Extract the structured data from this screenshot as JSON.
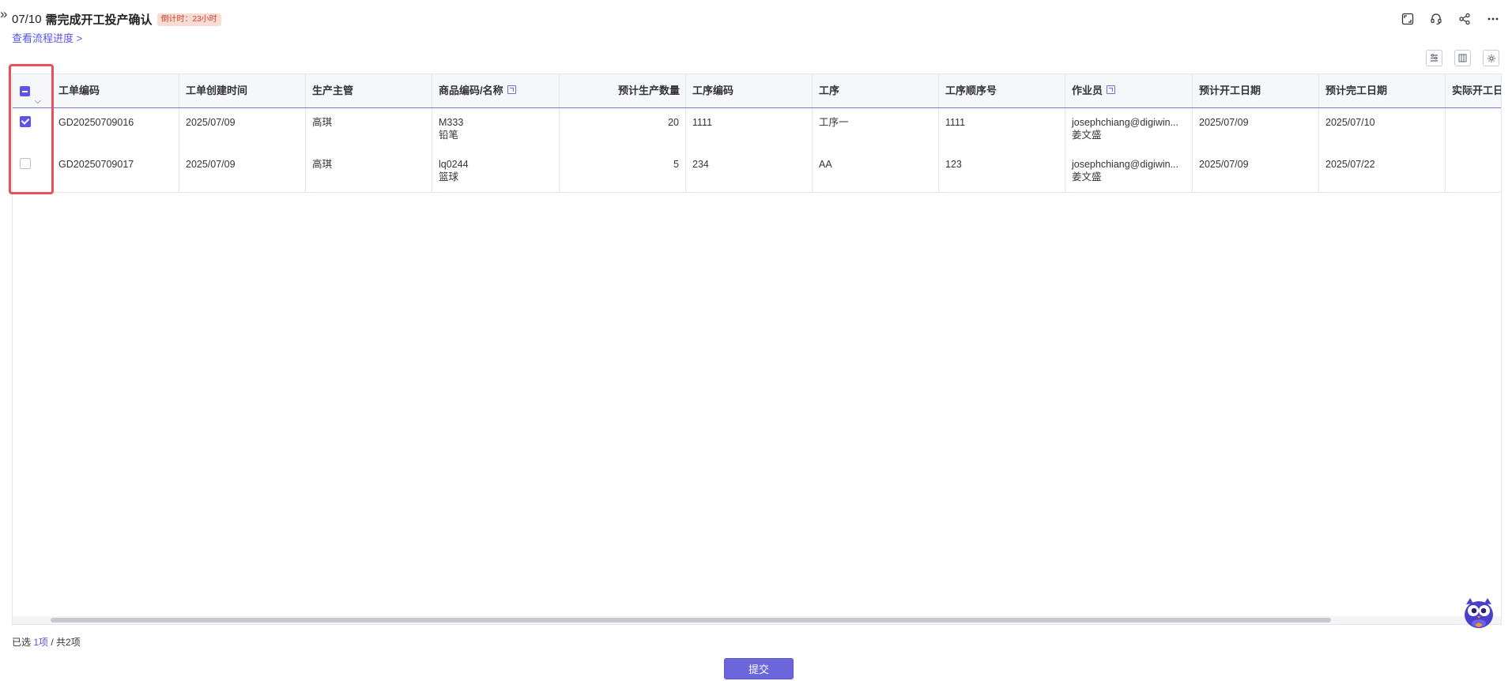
{
  "header": {
    "collapse_glyph": "»",
    "date": "07/10",
    "title": "需完成开工投产确认",
    "countdown": "倒计时：23小时",
    "progress_link": "查看流程进度 >"
  },
  "top_icons": [
    "fullscreen-icon",
    "headset-icon",
    "share-icon",
    "more-icon"
  ],
  "toolbar_icons": [
    "filter-settings-icon",
    "column-freeze-icon",
    "settings-icon"
  ],
  "table": {
    "columns": [
      {
        "label": "工单编码"
      },
      {
        "label": "工单创建时间"
      },
      {
        "label": "生产主管"
      },
      {
        "label": "商品编码/名称"
      },
      {
        "label": "预计生产数量"
      },
      {
        "label": "工序编码"
      },
      {
        "label": "工序"
      },
      {
        "label": "工序顺序号"
      },
      {
        "label": "作业员"
      },
      {
        "label": "预计开工日期"
      },
      {
        "label": "预计完工日期"
      },
      {
        "label": "实际开工日期"
      }
    ],
    "rows": [
      {
        "checked": true,
        "order_no": "GD20250709016",
        "created": "2025/07/09",
        "supervisor": "高琪",
        "item_code": "M333",
        "item_name": "铅笔",
        "qty": "20",
        "process_code": "1111",
        "process": "工序一",
        "seq": "1111",
        "operator_email": "josephchiang@digiwin...",
        "operator_name": "姜文盛",
        "plan_start": "2025/07/09",
        "plan_end": "2025/07/10",
        "actual_start": ""
      },
      {
        "checked": false,
        "order_no": "GD20250709017",
        "created": "2025/07/09",
        "supervisor": "高琪",
        "item_code": "lq0244",
        "item_name": "篮球",
        "qty": "5",
        "process_code": "234",
        "process": "AA",
        "seq": "123",
        "operator_email": "josephchiang@digiwin...",
        "operator_name": "姜文盛",
        "plan_start": "2025/07/09",
        "plan_end": "2025/07/22",
        "actual_start": ""
      }
    ]
  },
  "footer": {
    "selected_prefix": "已选 ",
    "selected_count": "1项",
    "selected_suffix": " / 共2项",
    "submit": "提交"
  },
  "colors": {
    "accent": "#5b54e6",
    "highlight": "#e8505b",
    "countdown_bg": "#fbdcd4"
  }
}
